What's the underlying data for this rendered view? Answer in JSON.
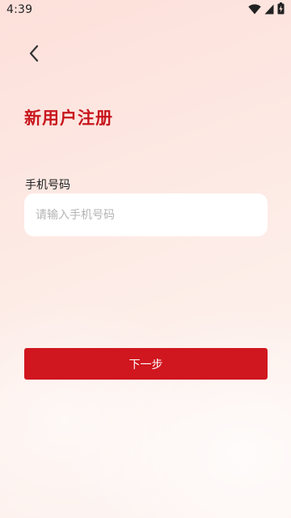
{
  "status_bar": {
    "time": "4:39",
    "icons": [
      "wifi-icon",
      "signal-icon",
      "battery-charging-icon"
    ]
  },
  "header": {
    "back_icon": "chevron-left-icon"
  },
  "page": {
    "title": "新用户注册"
  },
  "form": {
    "phone_label": "手机号码",
    "phone_value": "",
    "phone_placeholder": "请输入手机号码"
  },
  "actions": {
    "next_label": "下一步"
  },
  "colors": {
    "accent": "#d0161e",
    "title": "#c8161d",
    "background": "#fde8e3",
    "input_bg": "#ffffff",
    "placeholder": "#b4b4b4"
  }
}
